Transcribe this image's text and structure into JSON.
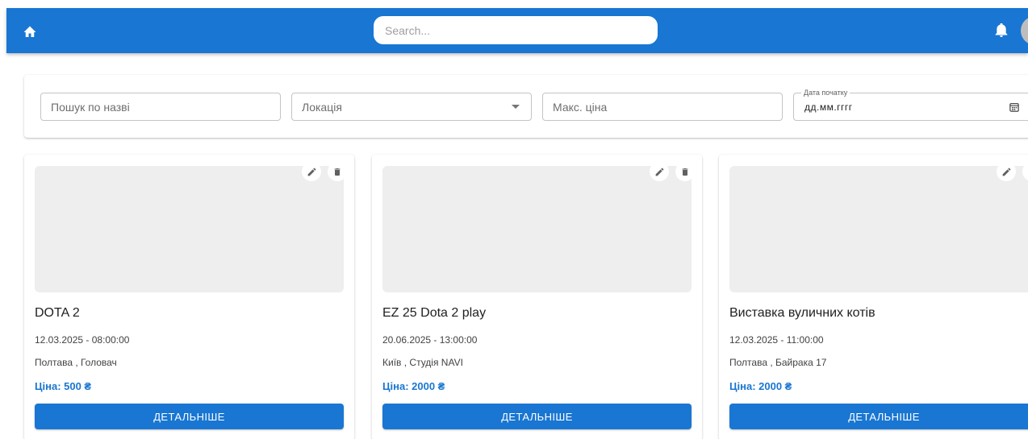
{
  "header": {
    "search_placeholder": "Search...",
    "icons": {
      "home": "home-icon",
      "notifications": "bell-icon",
      "avatar": "avatar"
    }
  },
  "filters": {
    "name_placeholder": "Пошук по назві",
    "location_label": "Локація",
    "price_placeholder": "Макс. ціна",
    "date_label": "Дата початку",
    "date_value": "дд.мм.гггг"
  },
  "events": [
    {
      "title": "DOTA 2",
      "datetime": "12.03.2025 - 08:00:00",
      "place": "Полтава , Головач",
      "price": "Ціна: 500 ₴",
      "button": "ДЕТАЛЬНІШЕ"
    },
    {
      "title": "EZ 25 Dota 2 play",
      "datetime": "20.06.2025 - 13:00:00",
      "place": "Київ , Студія NAVI",
      "price": "Ціна: 2000 ₴",
      "button": "ДЕТАЛЬНІШЕ"
    },
    {
      "title": "Виставка вуличних котів",
      "datetime": "12.03.2025 - 11:00:00",
      "place": "Полтава , Байрака 17",
      "price": "Ціна: 2000 ₴",
      "button": "ДЕТАЛЬНІШЕ"
    }
  ],
  "colors": {
    "primary": "#1976d2",
    "placeholder_bg": "#eeeeee",
    "avatar": "#bdbdbd"
  }
}
